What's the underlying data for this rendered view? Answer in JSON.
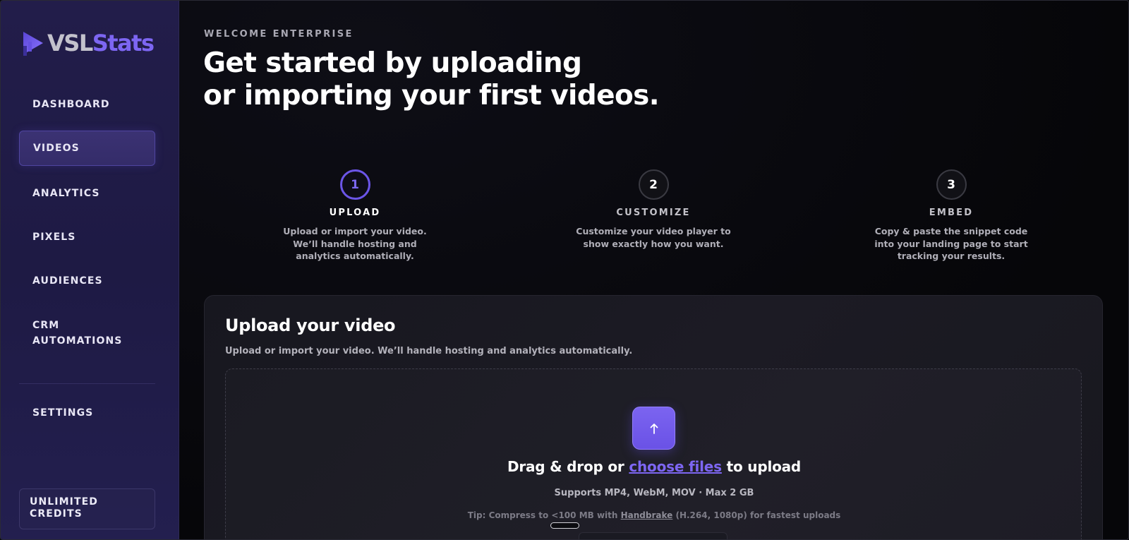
{
  "brand": {
    "name_part1": "VSL",
    "name_part2": "Stats",
    "accent": "#7d66f2"
  },
  "sidebar": {
    "items": [
      {
        "label": "DASHBOARD",
        "active": false
      },
      {
        "label": "VIDEOS",
        "active": true
      },
      {
        "label": "ANALYTICS",
        "active": false
      },
      {
        "label": "PIXELS",
        "active": false
      },
      {
        "label": "AUDIENCES",
        "active": false
      },
      {
        "label": "CRM",
        "label2": "AUTOMATIONS",
        "active": false
      },
      {
        "label": "SETTINGS",
        "active": false
      }
    ],
    "credits": {
      "line1": "UNLIMITED",
      "line2": "CREDITS"
    }
  },
  "main": {
    "welcome": "WELCOME ENTERPRISE",
    "headline_line1": "Get started by uploading",
    "headline_line2": "or importing your first videos.",
    "steps": [
      {
        "number": "1",
        "title": "UPLOAD",
        "desc": "Upload or import your video. We’ll handle hosting and analytics automatically.",
        "active": true
      },
      {
        "number": "2",
        "title": "CUSTOMIZE",
        "desc": "Customize your video player to show exactly how you want.",
        "active": false
      },
      {
        "number": "3",
        "title": "EMBED",
        "desc": "Copy & paste the snippet code into your landing page to start tracking your results.",
        "active": false
      }
    ],
    "upload_card": {
      "title": "Upload your video",
      "subtitle": "Upload or import your video. We’ll handle hosting and analytics automatically.",
      "drag_prefix": "Drag & drop or ",
      "drag_link": "choose files",
      "drag_suffix": " to upload",
      "supports": "Supports MP4, WebM, MOV · Max 2 GB",
      "tip_prefix": "Tip: Compress to <100 MB with ",
      "tip_link": "Handbrake",
      "tip_suffix": " (H.264, 1080p) for fastest uploads",
      "upload_icon": "arrow-up-icon"
    }
  }
}
